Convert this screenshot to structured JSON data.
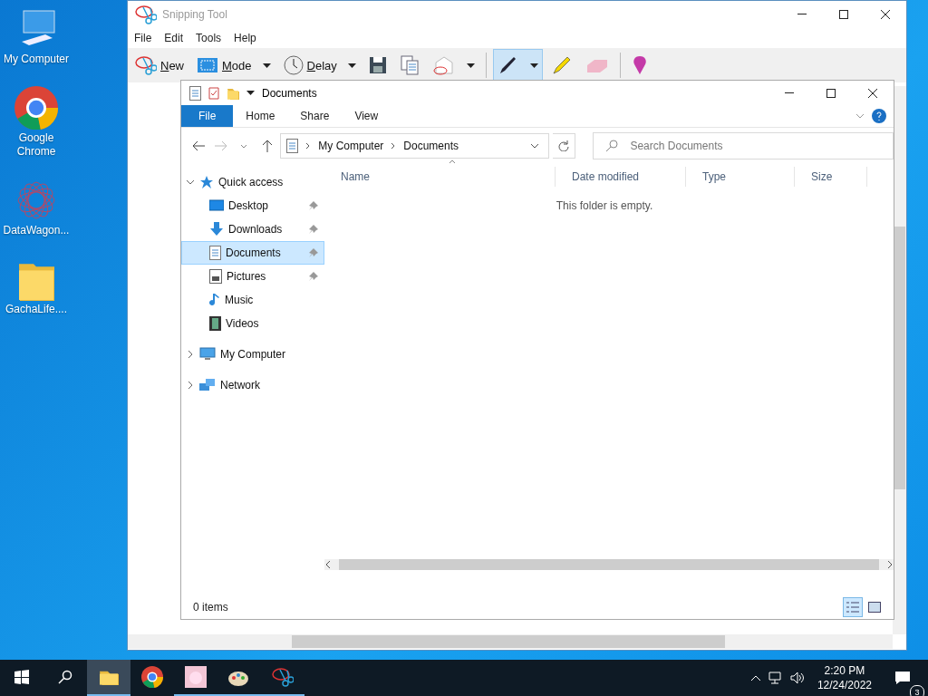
{
  "desktop_icons": [
    {
      "label": "My Computer",
      "kind": "computer"
    },
    {
      "label": "Google Chrome",
      "kind": "chrome"
    },
    {
      "label": "DataWagon...",
      "kind": "mesh"
    },
    {
      "label": "GachaLife....",
      "kind": "folder"
    }
  ],
  "snipping_tool": {
    "title": "Snipping Tool",
    "menu": [
      "File",
      "Edit",
      "Tools",
      "Help"
    ],
    "toolbar": [
      {
        "kind": "new",
        "label": "New"
      },
      {
        "kind": "mode",
        "label": "Mode"
      },
      {
        "kind": "delay",
        "label": "Delay"
      },
      {
        "kind": "save"
      },
      {
        "kind": "copy"
      },
      {
        "kind": "send"
      },
      {
        "kind": "pen",
        "selected": true
      },
      {
        "kind": "highlighter",
        "selected": false
      },
      {
        "kind": "eraser",
        "selected": false
      },
      {
        "kind": "paint3d"
      }
    ]
  },
  "explorer": {
    "title": "Documents",
    "ribbon_tabs": [
      {
        "label": "File",
        "kind": "file",
        "selected": false
      },
      {
        "label": "Home",
        "kind": "tab",
        "selected": false
      },
      {
        "label": "Share",
        "kind": "tab",
        "selected": false
      },
      {
        "label": "View",
        "kind": "tab",
        "selected": false
      }
    ],
    "path": [
      "My Computer",
      "Documents"
    ],
    "search": {
      "placeholder": "Search Documents"
    },
    "columns": [
      "Name",
      "Date modified",
      "Type",
      "Size"
    ],
    "empty_message": "This folder is empty.",
    "nav": [
      {
        "label": "Quick access",
        "kind": "star",
        "expanded": true,
        "selected": false,
        "children": [
          {
            "label": "Desktop",
            "kind": "desktop",
            "pinned": true,
            "selected": false
          },
          {
            "label": "Downloads",
            "kind": "download",
            "pinned": true,
            "selected": false
          },
          {
            "label": "Documents",
            "kind": "document",
            "pinned": true,
            "selected": true
          },
          {
            "label": "Pictures",
            "kind": "picture",
            "pinned": true,
            "selected": false
          },
          {
            "label": "Music",
            "kind": "music",
            "pinned": false,
            "selected": false
          },
          {
            "label": "Videos",
            "kind": "video",
            "pinned": false,
            "selected": false
          }
        ]
      },
      {
        "label": "My Computer",
        "kind": "computer",
        "expanded": false,
        "selected": false
      },
      {
        "label": "Network",
        "kind": "network",
        "expanded": false,
        "selected": false
      }
    ],
    "status": "0 items",
    "views": [
      {
        "kind": "details",
        "selected": true
      },
      {
        "kind": "tiles",
        "selected": false
      }
    ]
  },
  "taskbar": {
    "apps": [
      {
        "kind": "explorer",
        "selected": true,
        "running": true
      },
      {
        "kind": "chrome",
        "selected": false,
        "running": false
      },
      {
        "kind": "avatar",
        "selected": false,
        "running": true
      },
      {
        "kind": "palette",
        "selected": false,
        "running": true
      },
      {
        "kind": "snip",
        "selected": false,
        "running": true
      }
    ],
    "time": "2:20 PM",
    "date": "12/24/2022",
    "notifications": "3"
  }
}
